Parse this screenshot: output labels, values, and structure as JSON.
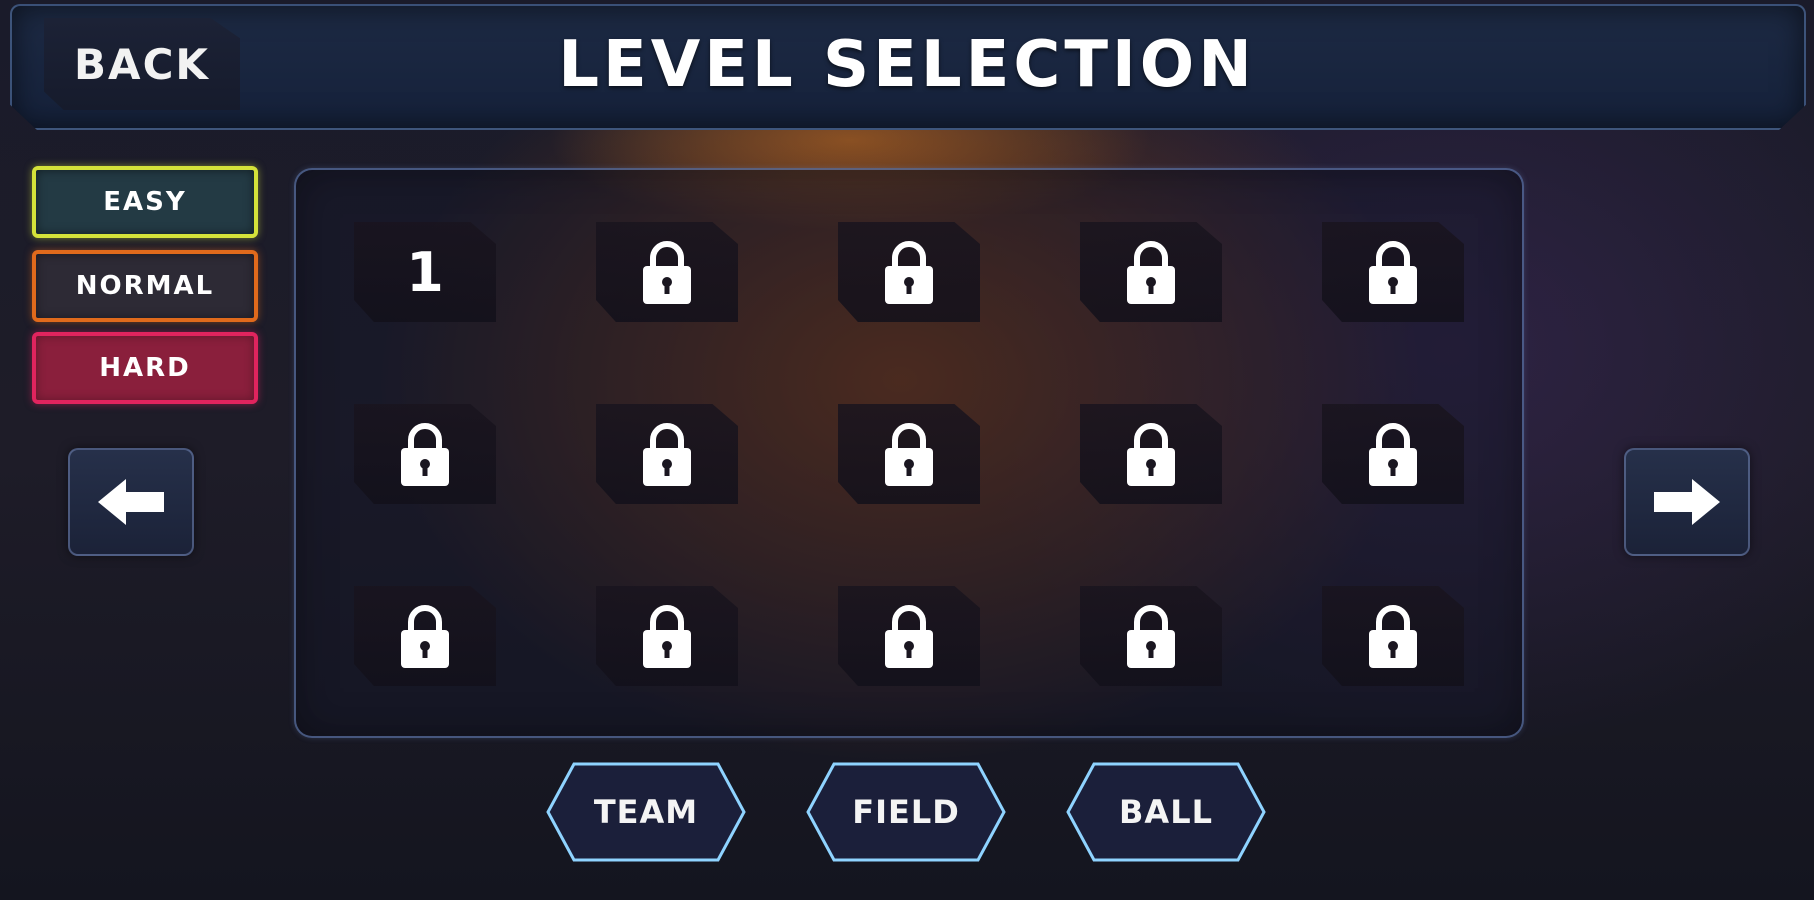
{
  "header": {
    "back_label": "BACK",
    "title": "LEVEL SELECTION"
  },
  "difficulty": {
    "selected": "EASY",
    "options": [
      {
        "label": "EASY",
        "color": "#d4e23a"
      },
      {
        "label": "NORMAL",
        "color": "#e06a1c"
      },
      {
        "label": "HARD",
        "color": "#e0245e"
      }
    ]
  },
  "navigation": {
    "prev_icon": "arrow-left-icon",
    "next_icon": "arrow-right-icon"
  },
  "levels": [
    {
      "label": "1",
      "locked": false
    },
    {
      "label": "",
      "locked": true
    },
    {
      "label": "",
      "locked": true
    },
    {
      "label": "",
      "locked": true
    },
    {
      "label": "",
      "locked": true
    },
    {
      "label": "",
      "locked": true
    },
    {
      "label": "",
      "locked": true
    },
    {
      "label": "",
      "locked": true
    },
    {
      "label": "",
      "locked": true
    },
    {
      "label": "",
      "locked": true
    },
    {
      "label": "",
      "locked": true
    },
    {
      "label": "",
      "locked": true
    },
    {
      "label": "",
      "locked": true
    },
    {
      "label": "",
      "locked": true
    },
    {
      "label": "",
      "locked": true
    }
  ],
  "locked_icon": "lock-icon",
  "bottom_tabs": {
    "team": "TEAM",
    "field": "FIELD",
    "ball": "BALL"
  },
  "colors": {
    "panel_border": "#6e8cc8",
    "tab_glow": "#8fd3ff"
  }
}
